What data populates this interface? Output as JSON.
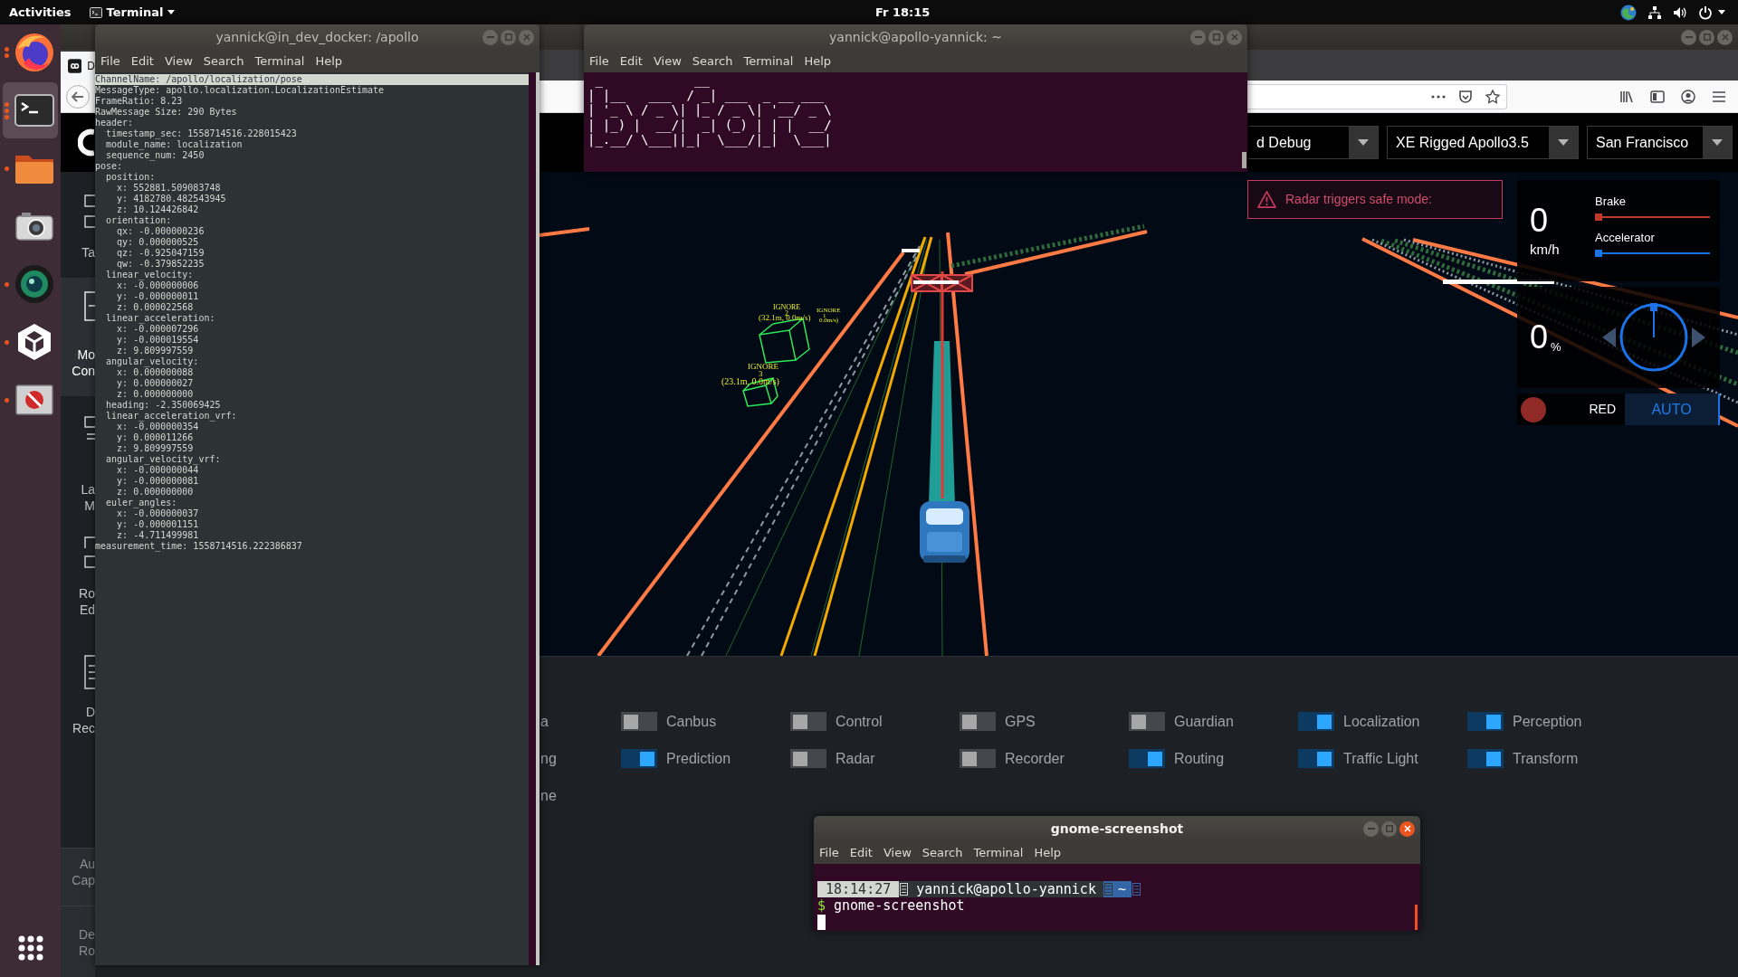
{
  "top_bar": {
    "activities": "Activities",
    "app_menu": "Terminal",
    "clock": "Fr 18:15"
  },
  "dock": [
    {
      "kind": "browser",
      "selected": false,
      "window_dots": [
        true,
        true
      ]
    },
    {
      "kind": "terminal",
      "selected": true,
      "window_dots": [
        true,
        true,
        true
      ]
    },
    {
      "kind": "files",
      "selected": false,
      "window_dots": [
        true
      ]
    },
    {
      "kind": "camera",
      "selected": false
    },
    {
      "kind": "lens",
      "selected": false,
      "window_dots": [
        true
      ]
    },
    {
      "kind": "unity",
      "selected": false,
      "window_dots": [
        true
      ]
    },
    {
      "kind": "blocked",
      "selected": false,
      "window_dots": [
        true
      ]
    }
  ],
  "log_terminal": {
    "title": "yannick@in_dev_docker: /apollo",
    "focused": false,
    "menu": [
      "File",
      "Edit",
      "View",
      "Search",
      "Terminal",
      "Help"
    ],
    "header_line": {
      "text": "ChannelName: /apollo/localization/pose",
      "highlighted": true
    },
    "lines": [
      {
        "text": "MessageType: apollo.localization.LocalizationEstimate"
      },
      {
        "text": "FrameRatio: 8.23"
      },
      {
        "text": "RawMessage Size: 290 Bytes"
      },
      {
        "text": "header:",
        "children": [
          {
            "text": "timestamp_sec: 1558714516.228015423"
          },
          {
            "text": "module_name: localization"
          },
          {
            "text": "sequence_num: 2450"
          }
        ]
      },
      {
        "text": "pose:",
        "children": [
          {
            "text": "position:",
            "children": [
              {
                "text": "x: 552881.509083748"
              },
              {
                "text": "y: 4182780.482543945"
              },
              {
                "text": "z: 10.124426842"
              }
            ]
          },
          {
            "text": "orientation:",
            "children": [
              {
                "text": "qx: -0.000000236"
              },
              {
                "text": "qy: 0.000000525"
              },
              {
                "text": "qz: -0.925047159"
              },
              {
                "text": "qw: -0.379852235"
              }
            ]
          },
          {
            "text": "linear_velocity:",
            "children": [
              {
                "text": "x: -0.000000006"
              },
              {
                "text": "y: -0.000000011"
              },
              {
                "text": "z: 0.000022568"
              }
            ]
          },
          {
            "text": "linear_acceleration:",
            "children": [
              {
                "text": "x: -0.000007296"
              },
              {
                "text": "y: -0.000019554"
              },
              {
                "text": "z: 9.809997559"
              }
            ]
          },
          {
            "text": "angular_velocity:",
            "children": [
              {
                "text": "x: 0.000000088"
              },
              {
                "text": "y: 0.000000027"
              },
              {
                "text": "z: 0.000000000"
              }
            ]
          },
          {
            "text": "heading: -2.350069425"
          },
          {
            "text": "linear_acceleration_vrf:",
            "children": [
              {
                "text": "x: -0.000000354"
              },
              {
                "text": "y: 0.000011266"
              },
              {
                "text": "z: 9.809997559"
              }
            ]
          },
          {
            "text": "angular_velocity_vrf:",
            "children": [
              {
                "text": "x: -0.000000044"
              },
              {
                "text": "y: -0.000000081"
              },
              {
                "text": "z: 0.000000000"
              }
            ]
          },
          {
            "text": "euler_angles:",
            "children": [
              {
                "text": "x: -0.000000037"
              },
              {
                "text": "y: -0.000001151"
              },
              {
                "text": "z: -4.711499981"
              }
            ]
          }
        ]
      },
      {
        "text": "measurement_time: 1558714516.222386837"
      }
    ]
  },
  "banner_terminal": {
    "title": "yannick@apollo-yannick: ~",
    "focused": false,
    "menu": [
      "File",
      "Edit",
      "View",
      "Search",
      "Terminal",
      "Help"
    ],
    "banner_lines": [
      " _            __",
      "| |__   ___  / _| ___  _ __ ___",
      "| '_ \\ / _ \\| |_ / _ \\| '__/ _ \\",
      "| |_) |  __/|  _| (_) | | |  __/",
      "|_.__/ \\___||_|  \\___/|_|  \\___|"
    ]
  },
  "browser": {
    "focused": false,
    "tab_label": "D",
    "dreamview": {
      "dropdowns": [
        {
          "value": "d Debug"
        },
        {
          "value": "XE Rigged Apollo3.5"
        },
        {
          "value": "San Francisco"
        }
      ],
      "sidebar": [
        {
          "kind": "tasks",
          "selected": false,
          "lines": [
            "Ta"
          ]
        },
        {
          "kind": "modules",
          "selected": true,
          "lines": [
            "Mo",
            "Con"
          ]
        },
        {
          "kind": "layers",
          "selected": false,
          "lines": [
            "La",
            "M"
          ]
        },
        {
          "kind": "route",
          "selected": false,
          "lines": [
            "Ro",
            "Ed"
          ]
        },
        {
          "kind": "recorder",
          "selected": false,
          "lines": [
            "D",
            "Rec"
          ]
        },
        {
          "kind": "audio",
          "selected": false,
          "lines": [
            "Au",
            "Cap"
          ]
        },
        {
          "kind": "routing",
          "selected": false,
          "lines": [
            "De",
            "Ro"
          ]
        }
      ],
      "scene": {
        "obstacle_labels": [
          {
            "status": "IGNORE",
            "id": "2",
            "reading": "(32.1m, 0.0m/s)"
          },
          {
            "status": "IGNORE",
            "id": "1",
            "reading": "0.0m/s)"
          },
          {
            "status": "IGNORE",
            "id": "3",
            "reading": "(23.1m, 0.0m/s)"
          }
        ]
      },
      "alert": {
        "kind": "warning",
        "text": "Radar triggers safe mode:"
      },
      "dashboard": {
        "speed": "0",
        "speed_unit": "km/h",
        "brake": {
          "label": "Brake",
          "level": 0
        },
        "accelerator": {
          "label": "Accelerator",
          "level": 0
        },
        "steering": "0",
        "steering_unit": "%",
        "traffic_light": {
          "kind": "red",
          "label": "RED"
        },
        "driving_mode": {
          "kind": "auto",
          "label": "AUTO"
        }
      },
      "modules": {
        "cut_labels": [
          "a",
          "ng",
          "ne"
        ],
        "items": [
          {
            "label": "Canbus",
            "on": false
          },
          {
            "label": "Control",
            "on": false
          },
          {
            "label": "GPS",
            "on": false
          },
          {
            "label": "Guardian",
            "on": false
          },
          {
            "label": "Localization",
            "on": true
          },
          {
            "label": "Perception",
            "on": true
          },
          {
            "label": "Prediction",
            "on": true
          },
          {
            "label": "Radar",
            "on": false
          },
          {
            "label": "Recorder",
            "on": false
          },
          {
            "label": "Routing",
            "on": true
          },
          {
            "label": "Traffic Light",
            "on": true
          },
          {
            "label": "Transform",
            "on": true
          }
        ]
      }
    }
  },
  "screenshot_terminal": {
    "title": "gnome-screenshot",
    "focused": true,
    "menu": [
      "File",
      "Edit",
      "View",
      "Search",
      "Terminal",
      "Help"
    ],
    "prompt": {
      "time": "18:14:27",
      "user_host": "yannick@apollo-yannick",
      "cwd": "~"
    },
    "command_line": {
      "symbol": "$",
      "command": "gnome-screenshot"
    },
    "cursor": true
  }
}
